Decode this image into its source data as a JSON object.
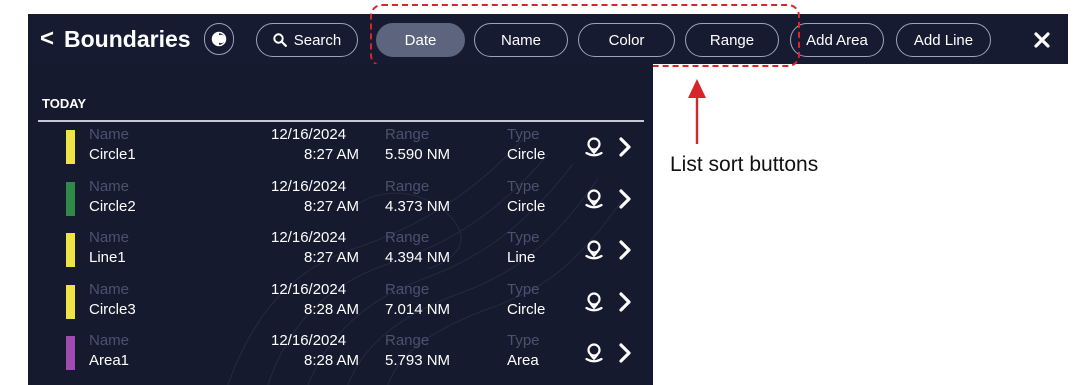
{
  "header": {
    "back_chevron": "<",
    "title": "Boundaries",
    "display_toggle_icon": "half-circle-icon",
    "search_label": "Search",
    "sort_buttons": [
      "Date",
      "Name",
      "Color",
      "Range"
    ],
    "active_sort": "Date",
    "add_area_label": "Add Area",
    "add_line_label": "Add Line",
    "close_icon": "close-icon"
  },
  "list": {
    "section": "TODAY",
    "field_labels": {
      "name": "Name",
      "range": "Range",
      "type": "Type"
    },
    "items": [
      {
        "name": "Circle1",
        "date": "12/16/2024",
        "time": "8:27 AM",
        "range": "5.590 NM",
        "type": "Circle",
        "color": "#eee445"
      },
      {
        "name": "Circle2",
        "date": "12/16/2024",
        "time": "8:27 AM",
        "range": "4.373 NM",
        "type": "Circle",
        "color": "#2e8a46"
      },
      {
        "name": "Line1",
        "date": "12/16/2024",
        "time": "8:27 AM",
        "range": "4.394 NM",
        "type": "Line",
        "color": "#eee445"
      },
      {
        "name": "Circle3",
        "date": "12/16/2024",
        "time": "8:28 AM",
        "range": "7.014 NM",
        "type": "Circle",
        "color": "#eee445"
      },
      {
        "name": "Area1",
        "date": "12/16/2024",
        "time": "8:28 AM",
        "range": "5.793 NM",
        "type": "Area",
        "color": "#a04bb0"
      }
    ]
  },
  "annotation": {
    "label": "List sort buttons",
    "color": "#d8242b"
  }
}
